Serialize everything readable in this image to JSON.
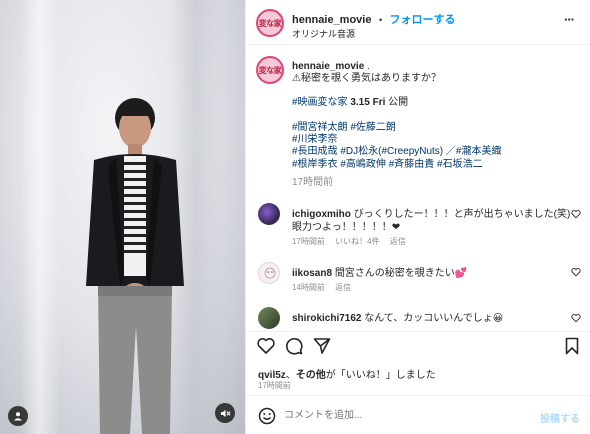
{
  "post": {
    "username": "hennaie_movie",
    "dot": "•",
    "follow_label": "フォローする",
    "audio": "オリジナル音源",
    "more": "···",
    "avatar_text": "変な家"
  },
  "caption": {
    "username": "hennaie_movie",
    "suffix": ".",
    "line1": "⚠秘密を覗く勇気はありますか？",
    "line2_tag": "#映画変な家",
    "line2_date": "3.15 Fri",
    "line2_rest": "公開",
    "line3": "#間宮祥太朗 #佐藤二朗",
    "line4": "#川栄李奈",
    "line5": "#長田成哉 #DJ松永(#CreepyNuts) ／#瀧本美織",
    "line6": "#根岸季衣 #高嶋政伸 #斉藤由貴 #石坂浩二",
    "time": "17時間前"
  },
  "comments": [
    {
      "user": "ichigoxmiho",
      "text": "びっくりしたー！！！と声が出ちゃいました(笑)",
      "text2": "眼力つよっ！！！！！❤",
      "time": "17時間前",
      "likes": "いいね！4件",
      "reply": "返信"
    },
    {
      "user": "iikosan8",
      "text": "間宮さんの秘密を覗きたい💕",
      "time": "14時間前",
      "reply": "返信"
    },
    {
      "user": "shirokichi7162",
      "text": "なんて、カッコいいんでしょ😀"
    }
  ],
  "likes": {
    "user": "qvil5z",
    "mid": "、",
    "others": "その他",
    "rest": "が「いいね！」しました",
    "time": "17時間前"
  },
  "comment_input": {
    "placeholder": "コメントを追加...",
    "post_label": "投稿する"
  },
  "icons": [
    "heart-icon",
    "comment-icon",
    "share-icon",
    "bookmark-icon",
    "emoji-icon",
    "more-icon",
    "user-tag-icon",
    "mute-icon"
  ],
  "colors": {
    "link": "#0095f6",
    "tag": "#00376b",
    "muted": "#8e8e8e",
    "brand_ring": "#e0457b"
  }
}
